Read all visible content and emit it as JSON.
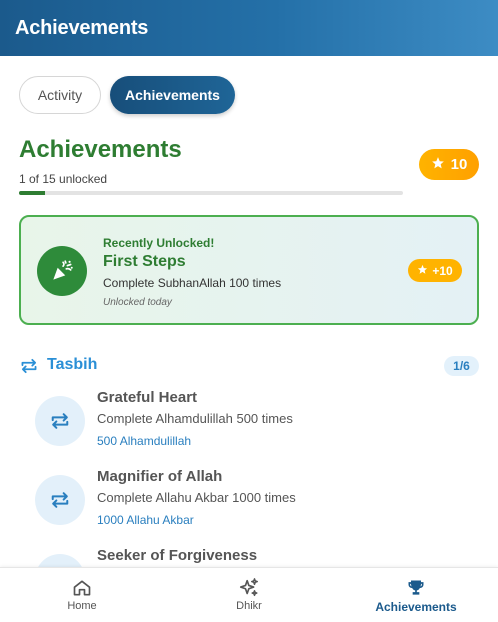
{
  "header": {
    "title": "Achievements"
  },
  "tabs": [
    {
      "label": "Activity",
      "active": false
    },
    {
      "label": "Achievements",
      "active": true
    }
  ],
  "summary": {
    "title": "Achievements",
    "unlocked_text": "1 of 15 unlocked",
    "progress_fraction": 0.0667,
    "points": "10",
    "points_icon": "star-icon"
  },
  "recent": {
    "label": "Recently Unlocked!",
    "title": "First Steps",
    "description": "Complete SubhanAllah 100 times",
    "date": "Unlocked today",
    "reward": "+10",
    "icon": "party-popper-icon"
  },
  "category": {
    "title": "Tasbih",
    "count": "1/6",
    "icon": "repeat-icon"
  },
  "achievements": [
    {
      "title": "Grateful Heart",
      "description": "Complete Alhamdulillah 500 times",
      "progress": "500 Alhamdulillah",
      "icon": "repeat-icon"
    },
    {
      "title": "Magnifier of Allah",
      "description": "Complete Allahu Akbar 1000 times",
      "progress": "1000 Allahu Akbar",
      "icon": "repeat-icon"
    },
    {
      "title": "Seeker of Forgiveness",
      "description": "",
      "progress": "",
      "icon": "repeat-icon"
    }
  ],
  "nav": [
    {
      "label": "Home",
      "icon": "home-icon",
      "active": false
    },
    {
      "label": "Dhikr",
      "icon": "sparkles-icon",
      "active": false
    },
    {
      "label": "Achievements",
      "icon": "trophy-icon",
      "active": true
    }
  ],
  "colors": {
    "primary": "#1b5a8c",
    "success": "#2e7d32",
    "gold": "#ffb300",
    "accent_blue": "#2a8fd6"
  }
}
